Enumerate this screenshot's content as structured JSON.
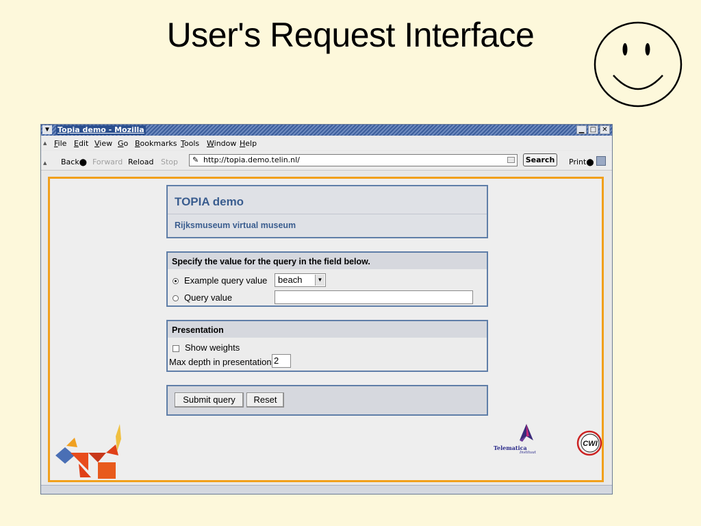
{
  "slide": {
    "title": "User's Request Interface"
  },
  "browser": {
    "window_title": "Topia demo - Mozilla",
    "menu": [
      "File",
      "Edit",
      "View",
      "Go",
      "Bookmarks",
      "Tools",
      "Window",
      "Help"
    ],
    "nav": {
      "back": "Back",
      "forward": "Forward",
      "reload": "Reload",
      "stop": "Stop",
      "print": "Print"
    },
    "url": "http://topia.demo.telin.nl/",
    "search_label": "Search"
  },
  "page": {
    "header": {
      "title": "TOPIA demo",
      "subtitle": "Rijksmuseum virtual museum"
    },
    "query": {
      "heading": "Specify the value for the query in the field below.",
      "example_label": "Example query value",
      "example_selected": "beach",
      "custom_label": "Query value",
      "custom_value": ""
    },
    "presentation": {
      "heading": "Presentation",
      "show_weights_label": "Show weights",
      "max_depth_label": "Max depth in presentation:",
      "max_depth_value": "2"
    },
    "actions": {
      "submit": "Submit query",
      "reset": "Reset"
    },
    "logos": {
      "telematica": "Telematica",
      "telematica_sub": "Instituut",
      "cwi": "CWI"
    }
  }
}
